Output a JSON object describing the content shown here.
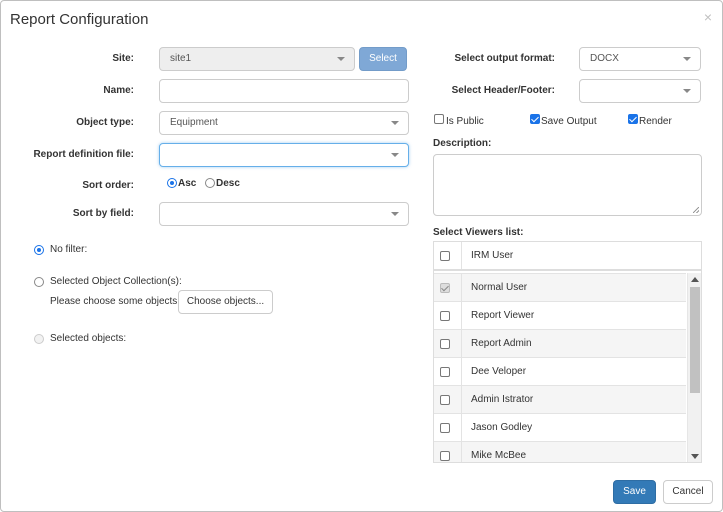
{
  "dialog": {
    "title": "Report Configuration",
    "close_glyph": "×"
  },
  "left": {
    "site_label": "Site:",
    "site_value": "site1",
    "select_button": "Select",
    "name_label": "Name:",
    "name_value": "",
    "object_type_label": "Object type:",
    "object_type_value": "Equipment",
    "report_def_label": "Report definition file:",
    "report_def_value": "",
    "sort_order_label": "Sort order:",
    "sort_asc": "Asc",
    "sort_desc": "Desc",
    "sort_order_selected": "Asc",
    "sort_field_label": "Sort by field:",
    "sort_field_value": "",
    "filter": {
      "no_filter": "No filter:",
      "selected_collection": "Selected Object Collection(s):",
      "choose_hint": "Please choose some objects.",
      "choose_button": "Choose objects...",
      "selected_objects": "Selected objects:",
      "selected": "No filter"
    }
  },
  "right": {
    "output_format_label": "Select output format:",
    "output_format_value": "DOCX",
    "header_footer_label": "Select Header/Footer:",
    "header_footer_value": "",
    "is_public": "Is Public",
    "is_public_checked": false,
    "save_output": "Save Output",
    "save_output_checked": true,
    "render": "Render",
    "render_checked": true,
    "description_label": "Description:",
    "description_value": "",
    "viewers_label": "Select Viewers list:",
    "viewers": [
      {
        "name": "IRM User",
        "checked": false
      },
      {
        "name": "Normal User",
        "checked": true,
        "disabled": true
      },
      {
        "name": "Report Viewer",
        "checked": false
      },
      {
        "name": "Report Admin",
        "checked": false
      },
      {
        "name": "Dee Veloper",
        "checked": false
      },
      {
        "name": "Admin Istrator",
        "checked": false
      },
      {
        "name": "Jason Godley",
        "checked": false
      },
      {
        "name": "Mike McBee",
        "checked": false
      }
    ]
  },
  "footer": {
    "save": "Save",
    "cancel": "Cancel"
  },
  "colors": {
    "primary": "#337ab7",
    "select_button": "#7fa8d6",
    "focus": "#66afe9",
    "check_accent": "#1a73e8"
  }
}
